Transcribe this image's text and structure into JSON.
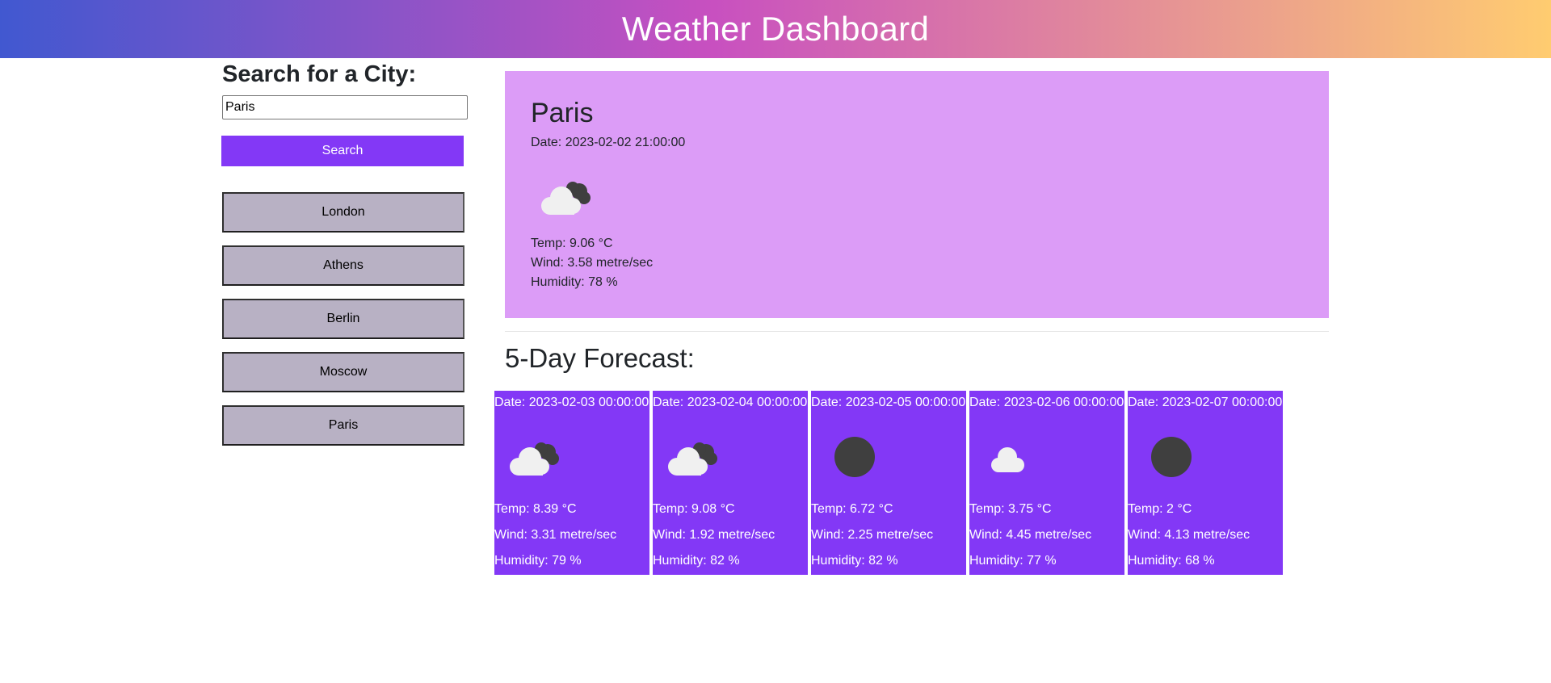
{
  "header": {
    "title": "Weather Dashboard"
  },
  "sidebar": {
    "heading": "Search for a City:",
    "search_value": "Paris",
    "search_button": "Search",
    "history": [
      "London",
      "Athens",
      "Berlin",
      "Moscow",
      "Paris"
    ]
  },
  "current": {
    "city": "Paris",
    "date": "Date: 2023-02-02 21:00:00",
    "icon": "broken-clouds-icon",
    "temp": "Temp: 9.06 °C",
    "wind": "Wind: 3.58 metre/sec",
    "humidity": "Humidity: 78 %"
  },
  "forecast": {
    "title": "5-Day Forecast:",
    "days": [
      {
        "date": "Date: 2023-02-03 00:00:00",
        "icon": "broken-clouds-icon",
        "temp": "Temp: 8.39 °C",
        "wind": "Wind: 3.31 metre/sec",
        "humidity": "Humidity: 79 %"
      },
      {
        "date": "Date: 2023-02-04 00:00:00",
        "icon": "broken-clouds-icon",
        "temp": "Temp: 9.08 °C",
        "wind": "Wind: 1.92 metre/sec",
        "humidity": "Humidity: 82 %"
      },
      {
        "date": "Date: 2023-02-05 00:00:00",
        "icon": "clear-night-icon",
        "temp": "Temp: 6.72 °C",
        "wind": "Wind: 2.25 metre/sec",
        "humidity": "Humidity: 82 %"
      },
      {
        "date": "Date: 2023-02-06 00:00:00",
        "icon": "few-clouds-icon",
        "temp": "Temp: 3.75 °C",
        "wind": "Wind: 4.45 metre/sec",
        "humidity": "Humidity: 77 %"
      },
      {
        "date": "Date: 2023-02-07 00:00:00",
        "icon": "clear-night-icon",
        "temp": "Temp: 2 °C",
        "wind": "Wind: 4.13 metre/sec",
        "humidity": "Humidity: 68 %"
      }
    ]
  },
  "colors": {
    "accent": "#8338f6",
    "current_card": "#dc9cf7",
    "history_button": "#b8b1c4"
  }
}
